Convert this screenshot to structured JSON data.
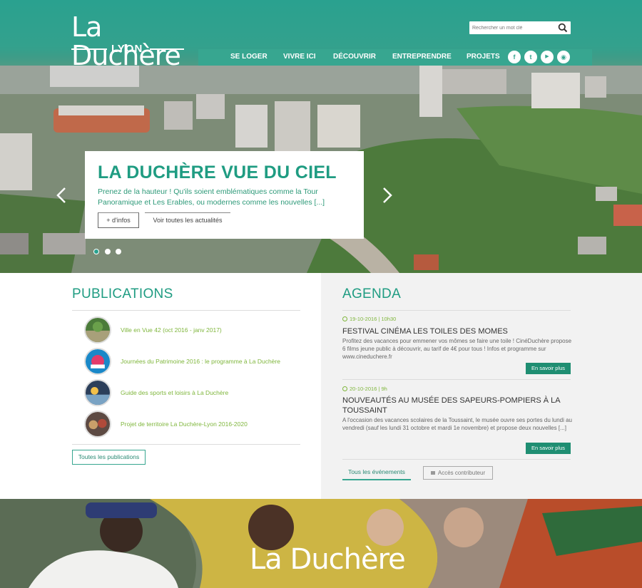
{
  "header": {
    "logo_main": "La Duchère",
    "logo_sub": "LYON",
    "search_placeholder": "Rechercher un mot clé",
    "nav": [
      "SE LOGER",
      "VIVRE ICI",
      "DÉCOUVRIR",
      "ENTREPRENDRE",
      "PROJETS"
    ],
    "social": [
      {
        "icon": "facebook-icon",
        "glyph": "f"
      },
      {
        "icon": "twitter-icon",
        "glyph": "t"
      },
      {
        "icon": "youtube-icon",
        "glyph": "▶"
      },
      {
        "icon": "rss-icon",
        "glyph": "◉"
      }
    ]
  },
  "slider": {
    "title": "LA DUCHÈRE VUE DU CIEL",
    "text": "Prenez de la hauteur ! Qu'ils soient emblématiques comme la Tour Panoramique et Les Erables, ou modernes comme les nouvelles [...]",
    "more_label": "+ d'infos",
    "all_news_label": "Voir toutes les actualités",
    "active_slide": 1,
    "slide_count": 3
  },
  "publications": {
    "title": "PUBLICATIONS",
    "items": [
      "Ville en Vue 42 (oct 2016 - janv 2017)",
      "Journées du Patrimoine 2016 : le programme à La Duchère",
      "Guide des sports et loisirs à La Duchère",
      "Projet de territoire La Duchère-Lyon 2016-2020"
    ],
    "all_label": "Toutes les publications"
  },
  "agenda": {
    "title": "AGENDA",
    "events": [
      {
        "date": "19-10-2016 | 10h30",
        "title": "FESTIVAL CINÉMA LES TOILES DES MOMES",
        "desc": "Profitez des vacances pour emmener vos mômes se faire une toile ! CinéDuchère propose 6 films jeune public à découvrir, au tarif de 4€ pour tous ! Infos et programme sur www.cineduchere.fr",
        "btn": "En savoir plus"
      },
      {
        "date": "20-10-2016 | 9h",
        "title": "NOUVEAUTÉS AU MUSÉE DES SAPEURS-POMPIERS À LA TOUSSAINT",
        "desc": "A l'occasion des vacances scolaires de la Toussaint, le musée ouvre ses portes du lundi au vendredi (sauf les lundi 31 octobre et mardi 1e novembre) et propose deux nouvelles [...]",
        "btn": "En savoir plus"
      }
    ],
    "all_label": "Tous les événements",
    "contrib_label": "Accès contributeur"
  },
  "banner": {
    "logo": "La Duchère"
  },
  "colors": {
    "brand_teal": "#2aa18f",
    "title_green": "#1f9c82",
    "link_lime": "#7fb63c"
  }
}
